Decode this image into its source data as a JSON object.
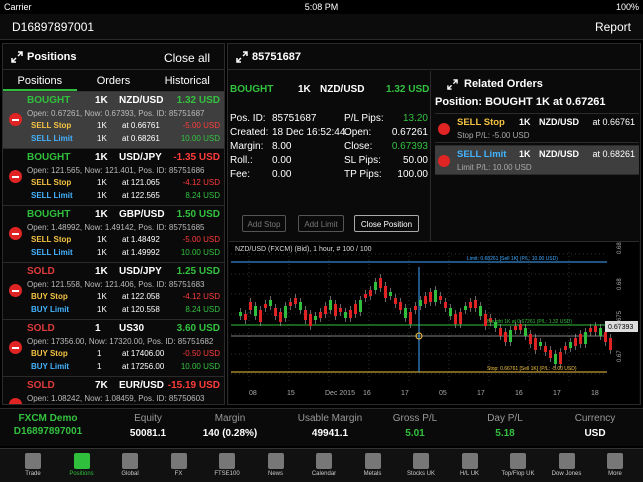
{
  "status_bar": {
    "carrier": "Carrier",
    "time": "5:08 PM",
    "battery": "100%"
  },
  "header": {
    "account": "D16897897001",
    "report_label": "Report"
  },
  "positions_panel": {
    "title": "Positions",
    "close_all": "Close all",
    "tabs": [
      "Positions",
      "Orders",
      "Historical"
    ],
    "items": [
      {
        "side": "BOUGHT",
        "qty": "1K",
        "symbol": "NZD/USD",
        "pl": "1.32 USD",
        "pl_color": "green",
        "info": "Open: 0.67261, Now: 0.67393, Pos. ID: 85751687",
        "o1_label": "SELL Stop",
        "o1_qty": "1K",
        "o1_rate": "at 0.66761",
        "o1_val": "-5.00 USD",
        "o2_label": "SELL Limit",
        "o2_qty": "1K",
        "o2_rate": "at 0.68261",
        "o2_val": "10.00 USD",
        "selected": true
      },
      {
        "side": "BOUGHT",
        "qty": "1K",
        "symbol": "USD/JPY",
        "pl": "-1.35 USD",
        "pl_color": "red",
        "info": "Open: 121.565, Now: 121.401, Pos. ID: 85751686",
        "o1_label": "SELL Stop",
        "o1_qty": "1K",
        "o1_rate": "at 121.065",
        "o1_val": "-4.12 USD",
        "o2_label": "SELL Limit",
        "o2_qty": "1K",
        "o2_rate": "at 122.565",
        "o2_val": "8.24 USD",
        "selected": false
      },
      {
        "side": "BOUGHT",
        "qty": "1K",
        "symbol": "GBP/USD",
        "pl": "1.50 USD",
        "pl_color": "green",
        "info": "Open: 1.48992, Now: 1.49142, Pos. ID: 85751685",
        "o1_label": "SELL Stop",
        "o1_qty": "1K",
        "o1_rate": "at 1.48492",
        "o1_val": "-5.00 USD",
        "o2_label": "SELL Limit",
        "o2_qty": "1K",
        "o2_rate": "at 1.49992",
        "o2_val": "10.00 USD",
        "selected": false
      },
      {
        "side": "SOLD",
        "qty": "1K",
        "symbol": "USD/JPY",
        "pl": "1.25 USD",
        "pl_color": "green",
        "info": "Open: 121.558, Now: 121.406, Pos. ID: 85751683",
        "o1_label": "BUY Stop",
        "o1_qty": "1K",
        "o1_rate": "at 122.058",
        "o1_val": "-4.12 USD",
        "o2_label": "BUY Limit",
        "o2_qty": "1K",
        "o2_rate": "at 120.558",
        "o2_val": "8.24 USD",
        "selected": false
      },
      {
        "side": "SOLD",
        "qty": "1",
        "symbol": "US30",
        "pl": "3.60 USD",
        "pl_color": "green",
        "info": "Open: 17356.00, Now: 17320.00, Pos. ID: 85751682",
        "o1_label": "BUY Stop",
        "o1_qty": "1",
        "o1_rate": "at 17406.00",
        "o1_val": "-0.50 USD",
        "o2_label": "BUY Limit",
        "o2_qty": "1",
        "o2_rate": "at 17256.00",
        "o2_val": "10.00 USD",
        "selected": false
      },
      {
        "side": "SOLD",
        "qty": "7K",
        "symbol": "EUR/USD",
        "pl": "-15.19 USD",
        "pl_color": "red",
        "info": "Open: 1.08242, Now: 1.08459, Pos. ID: 85750603",
        "o1_label": "",
        "o1_qty": "",
        "o1_rate": "",
        "o1_val": "",
        "o2_label": "",
        "o2_qty": "",
        "o2_rate": "",
        "o2_val": "",
        "selected": false
      }
    ]
  },
  "detail": {
    "id": "85751687",
    "side": "BOUGHT",
    "qty": "1K",
    "symbol": "NZD/USD",
    "pl": "1.32 USD",
    "fields_left": [
      {
        "label": "Pos. ID:",
        "value": "85751687"
      },
      {
        "label": "Created:",
        "value": "18 Dec 16:52:44"
      },
      {
        "label": "Margin:",
        "value": "8.00"
      },
      {
        "label": "Roll.:",
        "value": "0.00"
      },
      {
        "label": "Fee:",
        "value": "0.00"
      }
    ],
    "fields_right": [
      {
        "label": "P/L Pips:",
        "value": "13.20"
      },
      {
        "label": "Open:",
        "value": "0.67261"
      },
      {
        "label": "Close:",
        "value": "0.67393"
      },
      {
        "label": "SL Pips:",
        "value": "50.00"
      },
      {
        "label": "TP Pips:",
        "value": "100.00"
      }
    ],
    "buttons": [
      "Add Stop",
      "Add Limit",
      "Close Position"
    ]
  },
  "related": {
    "title": "Related Orders",
    "position": "Position: BOUGHT 1K at 0.67261",
    "orders": [
      {
        "label": "SELL Stop",
        "qty": "1K",
        "symbol": "NZD/USD",
        "rate": "at 0.66761",
        "sub": "Stop P/L: -5.00 USD"
      },
      {
        "label": "SELL Limit",
        "qty": "1K",
        "symbol": "NZD/USD",
        "rate": "at 0.68261",
        "sub": "Limit P/L: 10.00 USD"
      }
    ]
  },
  "chart": {
    "title": "NZD/USD (FXCM) (Bid), 1 hour, # 100 / 100",
    "current_price": "0.67393",
    "limit_label": "Limit: 0.68261 [Sell 1K] (P/L: 10.00 USD)",
    "open_label": "Bought 1K at 0.67261 (P/L: 1.32 USD)",
    "stop_label": "Stop: 0.66761 [Sell 1K] (P/L: -5.00 USD)",
    "tp_pips": "100 pips",
    "sl_pips": "50 pips",
    "y_ticks": [
      "0.685",
      "0.68",
      "0.675",
      "0.67"
    ],
    "x_ticks": [
      "08",
      "15",
      "Dec 2015",
      "16",
      "17",
      "05",
      "17",
      "16",
      "17",
      "18"
    ]
  },
  "summary": {
    "account_name": "FXCM Demo",
    "account_id": "D16897897001",
    "cols": [
      {
        "h": "Equity",
        "v": "50081.1"
      },
      {
        "h": "Margin",
        "v": "140 (0.28%)"
      },
      {
        "h": "Usable Margin",
        "v": "49941.1"
      },
      {
        "h": "Gross P/L",
        "v": "5.01"
      },
      {
        "h": "Day P/L",
        "v": "5.18"
      },
      {
        "h": "Currency",
        "v": "USD"
      }
    ]
  },
  "tabbar": [
    "Trade",
    "Positions",
    "Global",
    "FX",
    "FTSE100",
    "News",
    "Calendar",
    "Metals",
    "Stocks UK",
    "H/L UK",
    "Top/Flop UK",
    "Dow Jones",
    "More"
  ]
}
